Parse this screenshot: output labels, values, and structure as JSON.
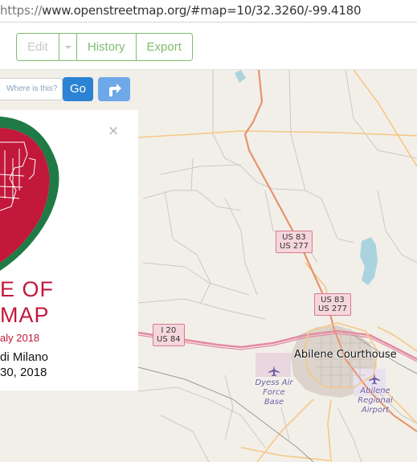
{
  "browser": {
    "url_scheme": "https://",
    "url_rest": "www.openstreetmap.org/#map=10/32.3260/-99.4180"
  },
  "toolbar": {
    "edit_label": "Edit",
    "history_label": "History",
    "export_label": "Export"
  },
  "search": {
    "placeholder": "Where is this?",
    "go_label": "Go"
  },
  "banner": {
    "title_line1": "E OF",
    "title_line2": "MAP",
    "date_line": "aly 2018",
    "venue_line": "di Milano",
    "range_line": "30, 2018",
    "accent_color": "#c2183a",
    "secondary_color": "#1f7a45"
  },
  "map": {
    "shields": [
      {
        "line1": "US 83",
        "line2": "US 277"
      },
      {
        "line1": "US 83",
        "line2": "US 277"
      },
      {
        "line1": "I 20",
        "line2": "US 84"
      }
    ],
    "city_label": "Abilene Courthouse",
    "airbase_label": [
      "Dyess Air",
      "Force Base"
    ],
    "airport_label": [
      "Abilene",
      "Regional",
      "Airport"
    ],
    "colors": {
      "land": "#f2efe9",
      "primary_road": "#e8926c",
      "trunk_road": "#e48aa0",
      "secondary_road": "#f5c884",
      "water": "#aad3df",
      "urban": "#d9d0c9"
    }
  }
}
